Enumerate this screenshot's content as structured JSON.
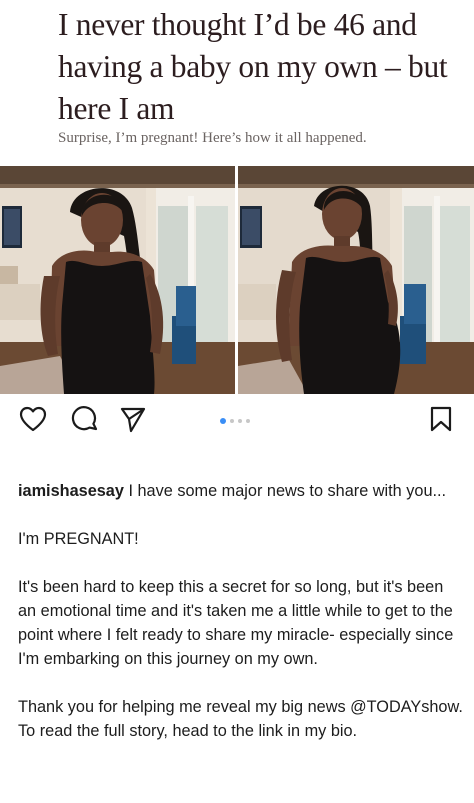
{
  "article": {
    "headline": "I never thought I’d be 46 and having a baby on my own – but here I am",
    "subhead": "Surprise, I’m pregnant! Here’s how it all happened."
  },
  "carousel": {
    "slide_count": 4,
    "active_index": 0
  },
  "icons": {
    "like": "heart-icon",
    "comment": "comment-icon",
    "share": "send-icon",
    "save": "bookmark-icon"
  },
  "post": {
    "username": "iamishasesay",
    "caption_intro": "I have some major news to share with you...",
    "paragraph_2": "I'm PREGNANT!",
    "paragraph_3": "It's been hard to keep this a secret for so long, but it's been an emotional time and it's taken me a little while to get to the point where I felt ready to share my miracle- especially since I'm embarking on this journey on my own.",
    "paragraph_4_start": "Thank you for helping me reveal my big news ",
    "mention": "@TODAYshow",
    "paragraph_4_end": ". To read the full story, head to the link in my bio."
  },
  "colors": {
    "headline": "#2c1d1f",
    "subhead": "#6b6462",
    "active_dot": "#3a8ef6",
    "inactive_dot": "#c7c7c7"
  }
}
